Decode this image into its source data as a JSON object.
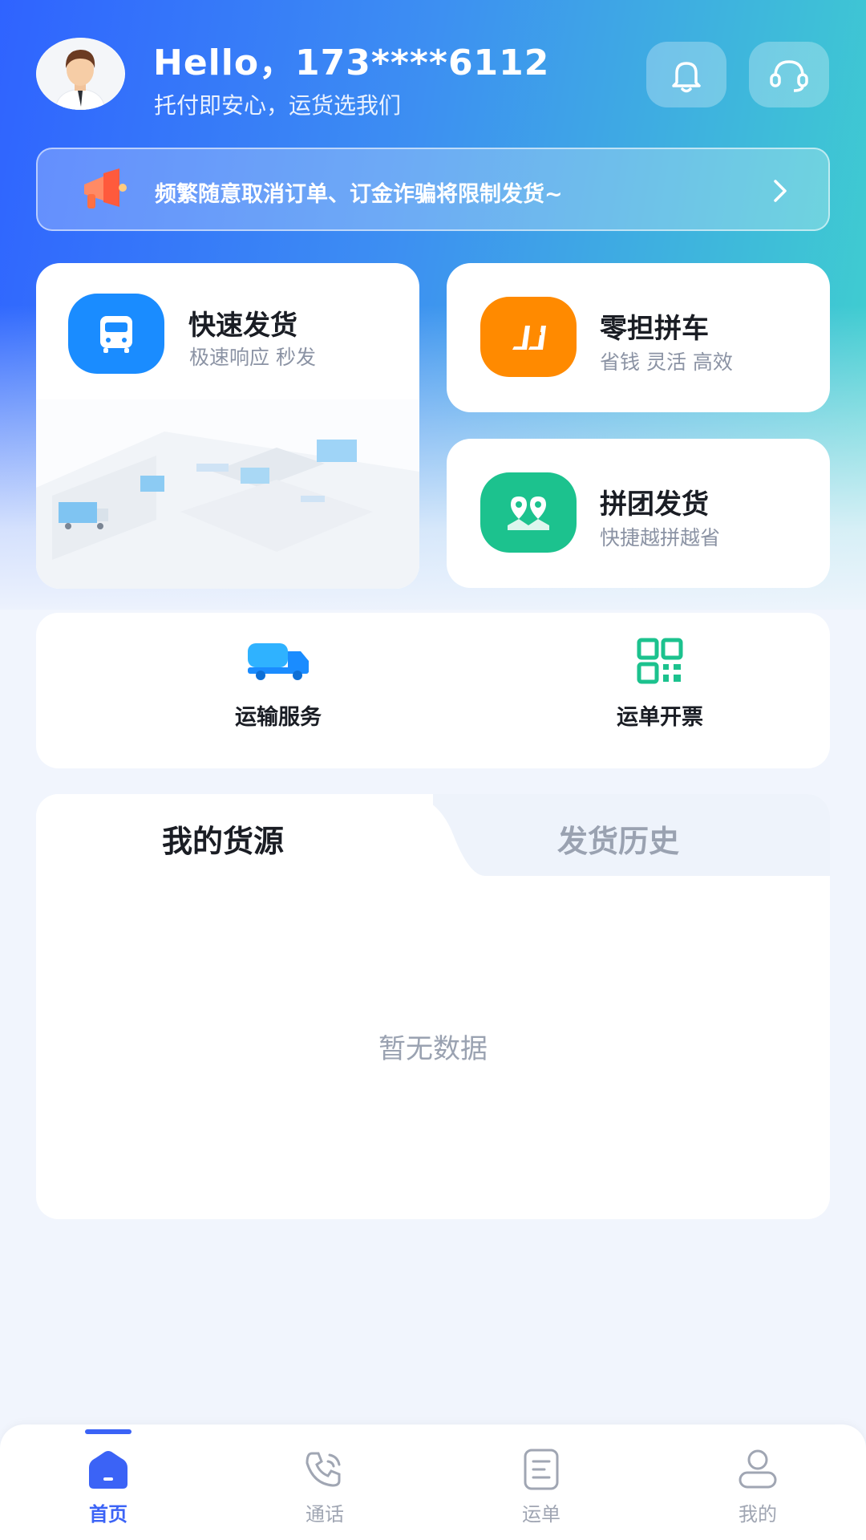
{
  "header": {
    "greeting": "Hello，173****6112",
    "slogan": "托付即安心，运货选我们",
    "icons": [
      "avatar",
      "bell-icon",
      "headset-icon"
    ]
  },
  "notice": {
    "text": "频繁随意取消订单、订金诈骗将限制发货~",
    "icon": "megaphone-icon"
  },
  "services": [
    {
      "title": "快速发货",
      "subtitle": "极速响应 秒发",
      "icon": "truck-front-icon",
      "color": "#1a8cff"
    },
    {
      "title": "零担拼车",
      "subtitle": "省钱 灵活 高效",
      "icon": "seats-icon",
      "color": "#ff8a00"
    },
    {
      "title": "拼团发货",
      "subtitle": "快捷越拼越省",
      "icon": "map-pin-icon",
      "color": "#1cc28e"
    }
  ],
  "tools": [
    {
      "label": "运输服务",
      "icon": "tanker-truck-icon",
      "color": "#2fb2ff"
    },
    {
      "label": "运单开票",
      "icon": "qr-code-icon",
      "color": "#1cc28e"
    }
  ],
  "tabs": {
    "active": "我的货源",
    "inactive": "发货历史",
    "empty_text": "暂无数据"
  },
  "nav": {
    "items": [
      {
        "label": "首页",
        "icon": "home-icon"
      },
      {
        "label": "通话",
        "icon": "phone-icon"
      },
      {
        "label": "运单",
        "icon": "waybill-icon"
      },
      {
        "label": "我的",
        "icon": "profile-icon"
      }
    ],
    "active_color": "#3b63f6",
    "inactive_color": "#a0a6b3"
  }
}
